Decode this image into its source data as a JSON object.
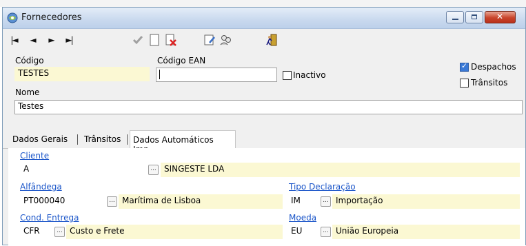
{
  "window": {
    "title": "Fornecedores"
  },
  "toolbar": {
    "first": "|◄",
    "prev": "◄",
    "next": "►",
    "last": "►|"
  },
  "form": {
    "codigo_label": "Código",
    "codigo_value": "TESTES",
    "ean_label": "Código EAN",
    "ean_value": "",
    "inactivo_label": "Inactivo",
    "despachos_label": "Despachos",
    "transitos_label": "Trânsitos",
    "nome_label": "Nome",
    "nome_value": "Testes"
  },
  "tabs": [
    {
      "label": "Dados Gerais"
    },
    {
      "label": "Trânsitos"
    },
    {
      "label": "Dados Automáticos Imp."
    }
  ],
  "panel": {
    "cliente_label": "Cliente",
    "cliente_code": "A",
    "cliente_name": "SINGESTE LDA",
    "alfandega_label": "Alfândega",
    "alfandega_code": "PT000040",
    "alfandega_name": "Marítima de Lisboa",
    "tipo_label": "Tipo Declaração",
    "tipo_code": "IM",
    "tipo_name": "Importação",
    "cond_label": "Cond. Entrega",
    "cond_code": "CFR",
    "cond_name": "Custo e Frete",
    "moeda_label": "Moeda",
    "moeda_code": "EU",
    "moeda_name": "União Europeia",
    "ellipsis": "..."
  }
}
